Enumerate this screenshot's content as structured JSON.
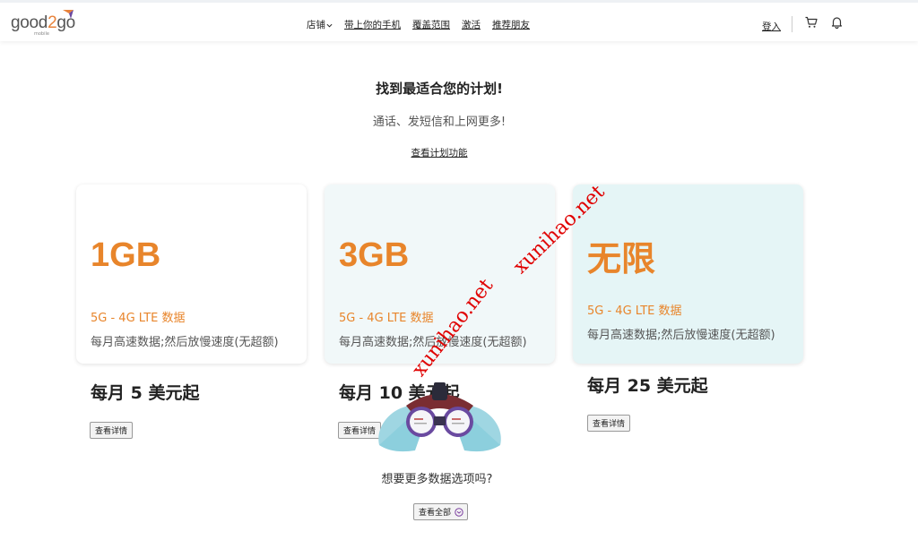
{
  "header": {
    "logo_text_a": "good",
    "logo_text_b": "2",
    "logo_text_c": "go",
    "logo_sub": "mobile",
    "nav": [
      {
        "label": "店铺",
        "has_dropdown": true
      },
      {
        "label": "带上你的手机"
      },
      {
        "label": "覆盖范围"
      },
      {
        "label": "激活"
      },
      {
        "label": "推荐朋友"
      }
    ],
    "login": "登入",
    "icons": [
      "cart-icon",
      "bell-icon"
    ]
  },
  "hero": {
    "title": "找到最适合您的计划!",
    "subtitle": "通话、发短信和上网更多!",
    "link": "查看计划功能"
  },
  "plans": [
    {
      "data": "1GB",
      "network": "5G - 4G LTE 数据",
      "desc": "每月高速数据;然后放慢速度(无超额)",
      "price": "每月 5 美元起",
      "button": "查看详情"
    },
    {
      "data": "3GB",
      "network": "5G - 4G LTE 数据",
      "desc": "每月高速数据;然后放慢速度(无超额)",
      "price": "每月 10 美元起",
      "button": "查看详情"
    },
    {
      "data": "无限",
      "network": "5G - 4G LTE 数据",
      "desc": "每月高速数据;然后放慢速度(无超额)",
      "price": "每月 25 美元起",
      "button": "查看详情"
    }
  ],
  "more": {
    "question": "想要更多数据选项吗?",
    "button": "查看全部"
  },
  "watermark": "xunihao.net",
  "colors": {
    "accent": "#e8852b",
    "card2_bg": "#f1f8f9",
    "card3_bg": "#e5f5f6",
    "watermark": "#e00000"
  }
}
